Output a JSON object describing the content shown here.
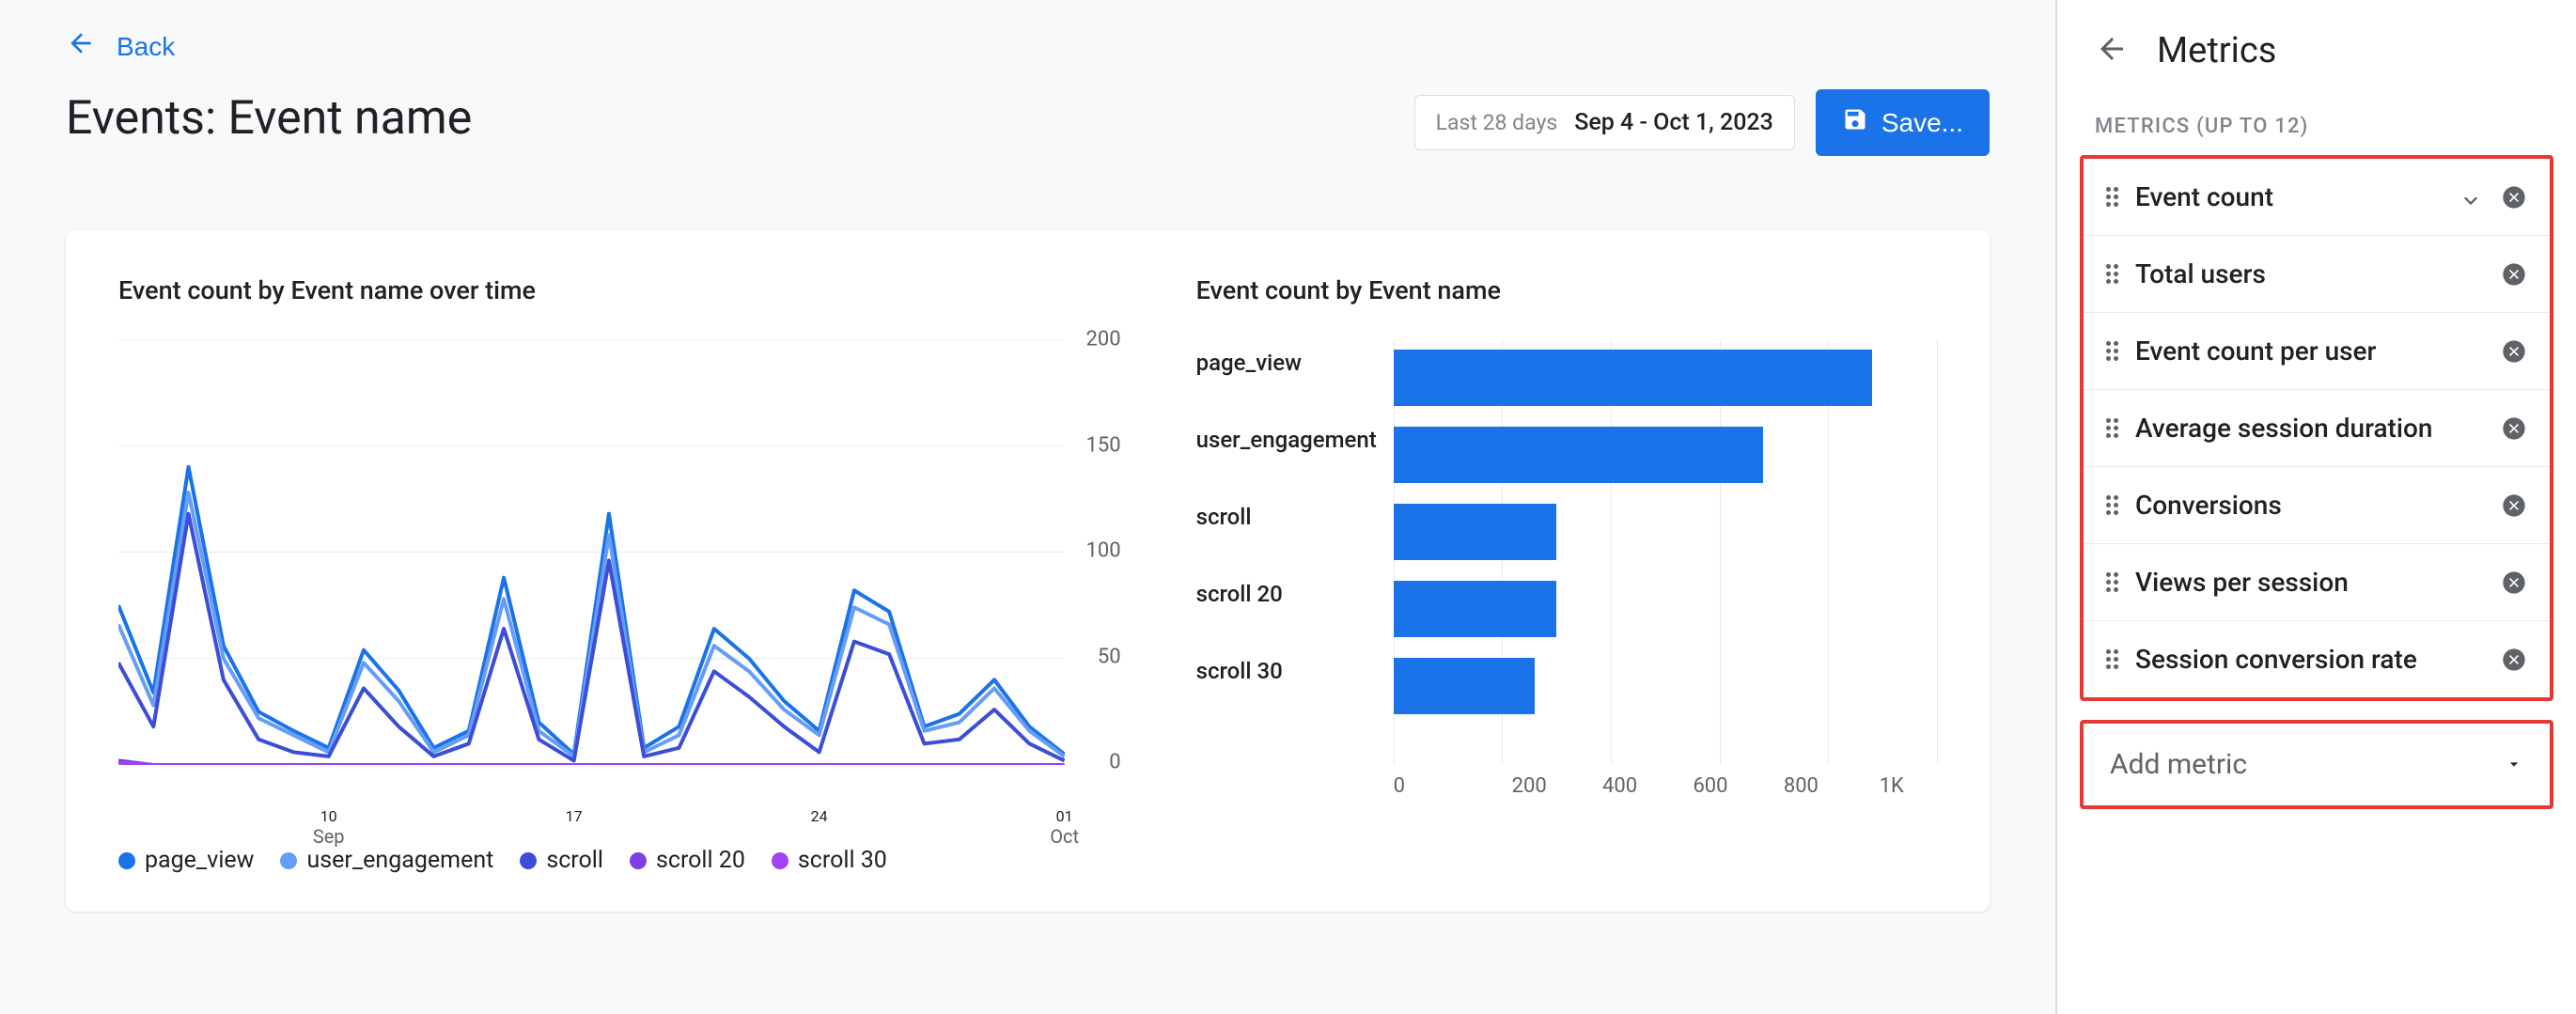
{
  "header": {
    "back_label": "Back",
    "title": "Events: Event name",
    "date_relative": "Last 28 days",
    "date_absolute": "Sep 4 - Oct 1, 2023",
    "save_label": "Save..."
  },
  "chart1_title": "Event count by Event name over time",
  "chart2_title": "Event count by Event name",
  "legend_items": [
    {
      "label": "page_view",
      "color": "#1a73e8"
    },
    {
      "label": "user_engagement",
      "color": "#669df6"
    },
    {
      "label": "scroll",
      "color": "#3c4ed8"
    },
    {
      "label": "scroll 20",
      "color": "#7b3fe4"
    },
    {
      "label": "scroll 30",
      "color": "#a142f4"
    }
  ],
  "side": {
    "title": "Metrics",
    "subtitle": "METRICS (UP TO 12)",
    "add_label": "Add metric",
    "metrics": [
      {
        "name": "Event count",
        "sorted": true
      },
      {
        "name": "Total users"
      },
      {
        "name": "Event count per user"
      },
      {
        "name": "Average session duration"
      },
      {
        "name": "Conversions"
      },
      {
        "name": "Views per session"
      },
      {
        "name": "Session conversion rate"
      }
    ]
  },
  "chart_data": [
    {
      "type": "line",
      "title": "Event count by Event name over time",
      "xlabel": "",
      "ylabel": "",
      "ylim": [
        0,
        200
      ],
      "yticks": [
        0,
        50,
        100,
        150,
        200
      ],
      "xticks": [
        {
          "pos": 6,
          "label": "10",
          "sub": "Sep"
        },
        {
          "pos": 13,
          "label": "17",
          "sub": ""
        },
        {
          "pos": 20,
          "label": "24",
          "sub": ""
        },
        {
          "pos": 27,
          "label": "01",
          "sub": "Oct"
        }
      ],
      "x": [
        0,
        1,
        2,
        3,
        4,
        5,
        6,
        7,
        8,
        9,
        10,
        11,
        12,
        13,
        14,
        15,
        16,
        17,
        18,
        19,
        20,
        21,
        22,
        23,
        24,
        25,
        26,
        27
      ],
      "series": [
        {
          "name": "page_view",
          "color": "#1a73e8",
          "values": [
            75,
            34,
            140,
            56,
            25,
            16,
            8,
            54,
            35,
            8,
            16,
            88,
            20,
            5,
            118,
            8,
            18,
            64,
            50,
            30,
            16,
            82,
            72,
            18,
            24,
            40,
            18,
            5
          ]
        },
        {
          "name": "user_engagement",
          "color": "#669df6",
          "values": [
            66,
            28,
            128,
            50,
            22,
            14,
            6,
            48,
            30,
            6,
            14,
            78,
            16,
            4,
            108,
            6,
            14,
            56,
            44,
            26,
            14,
            74,
            66,
            16,
            20,
            36,
            16,
            4
          ]
        },
        {
          "name": "scroll",
          "color": "#3c4ed8",
          "values": [
            48,
            18,
            118,
            40,
            12,
            6,
            4,
            36,
            18,
            4,
            10,
            64,
            12,
            2,
            96,
            4,
            8,
            44,
            32,
            18,
            6,
            58,
            52,
            10,
            12,
            26,
            10,
            2
          ]
        },
        {
          "name": "scroll 20",
          "color": "#7b3fe4",
          "values": [
            2,
            0,
            0,
            0,
            0,
            0,
            0,
            0,
            0,
            0,
            0,
            0,
            0,
            0,
            0,
            0,
            0,
            0,
            0,
            0,
            0,
            0,
            0,
            0,
            0,
            0,
            0,
            0
          ]
        },
        {
          "name": "scroll 30",
          "color": "#a142f4",
          "values": [
            1,
            0,
            0,
            0,
            0,
            0,
            0,
            0,
            0,
            0,
            0,
            0,
            0,
            0,
            0,
            0,
            0,
            0,
            0,
            0,
            0,
            0,
            0,
            0,
            0,
            0,
            0,
            0
          ]
        }
      ]
    },
    {
      "type": "bar",
      "orientation": "horizontal",
      "title": "Event count by Event name",
      "xlabel": "",
      "ylabel": "",
      "xlim": [
        0,
        1000
      ],
      "xticks": [
        0,
        200,
        400,
        600,
        800,
        "1K"
      ],
      "categories": [
        "page_view",
        "user_engagement",
        "scroll",
        "scroll 20",
        "scroll 30"
      ],
      "values": [
        880,
        680,
        300,
        300,
        260
      ]
    }
  ]
}
